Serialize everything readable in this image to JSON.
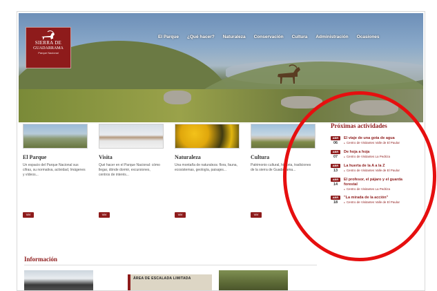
{
  "logo": {
    "line1": "SIERRA DE",
    "line2": "GUADARRAMA",
    "line3": "Parque Nacional"
  },
  "nav": [
    "El Parque",
    "¿Qué hacer?",
    "Naturaleza",
    "Conservación",
    "Cultura",
    "Administración",
    "Ocasiones"
  ],
  "cards": [
    {
      "title": "El Parque",
      "text": "Un espacio del Parque Nacional sus cifras, su normativa, actividad, Imágenes y vídeos...",
      "button": "Ver"
    },
    {
      "title": "Visita",
      "text": "Qué hacer en el Parque Nacional: cómo llegar, dónde dormir, excursiones, centros de interés...",
      "button": "Ver"
    },
    {
      "title": "Naturaleza",
      "text": "Una montaña de naturaleza: flora, fauna, ecosistemas, geología, paisajes...",
      "button": "Ver"
    },
    {
      "title": "Cultura",
      "text": "Patrimonio cultural, historia, tradiciones de la sierra de Guadarrama...",
      "button": "Ver"
    }
  ],
  "activities": {
    "title": "Próximas actividades",
    "items": [
      {
        "month": "ABR",
        "day": "06",
        "title": "El viaje de una gota de agua",
        "location": "Centro de Visitantes Valle de El Paular"
      },
      {
        "month": "ABR",
        "day": "07",
        "title": "De hoja a hoja",
        "location": "Centro de Visitantes La Pedriza"
      },
      {
        "month": "ABR",
        "day": "13",
        "title": "La huerta de la A a la Z",
        "location": "Centro de Visitantes Valle de El Paular"
      },
      {
        "month": "ABR",
        "day": "14",
        "title": "El profesor, el pájaro y el guarda forestal",
        "location": "Centro de Visitantes La Pedriza"
      },
      {
        "month": "ABR",
        "day": "18",
        "title": "\"La mirada de la acción\"",
        "location": "Centro de Visitantes Valle de El Paular"
      }
    ]
  },
  "info": {
    "title": "Información",
    "banner": "ÁREA DE ESCALADA LIMITADA"
  },
  "colors": {
    "accent": "#8e1b1b",
    "annotation": "#e60f0f"
  }
}
